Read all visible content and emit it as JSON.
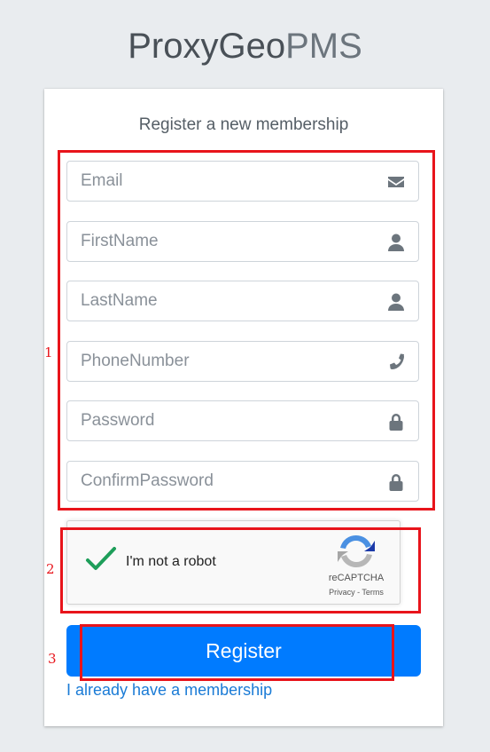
{
  "logo": {
    "bold": "ProxyGeo",
    "light": "PMS"
  },
  "card": {
    "title": "Register a new membership"
  },
  "fields": [
    {
      "placeholder": "Email",
      "icon": "envelope-icon"
    },
    {
      "placeholder": "FirstName",
      "icon": "user-icon"
    },
    {
      "placeholder": "LastName",
      "icon": "user-icon"
    },
    {
      "placeholder": "PhoneNumber",
      "icon": "phone-icon"
    },
    {
      "placeholder": "Password",
      "icon": "lock-icon"
    },
    {
      "placeholder": "ConfirmPassword",
      "icon": "lock-icon"
    }
  ],
  "captcha": {
    "label": "I'm not a robot",
    "brand": "reCAPTCHA",
    "links": "Privacy - Terms"
  },
  "register_button": "Register",
  "login_link": "I already have a membership",
  "annotations": [
    "1",
    "2",
    "3"
  ],
  "colors": {
    "annotation": "#e8141b",
    "primary": "#007bff",
    "link": "#1a7bd6"
  }
}
